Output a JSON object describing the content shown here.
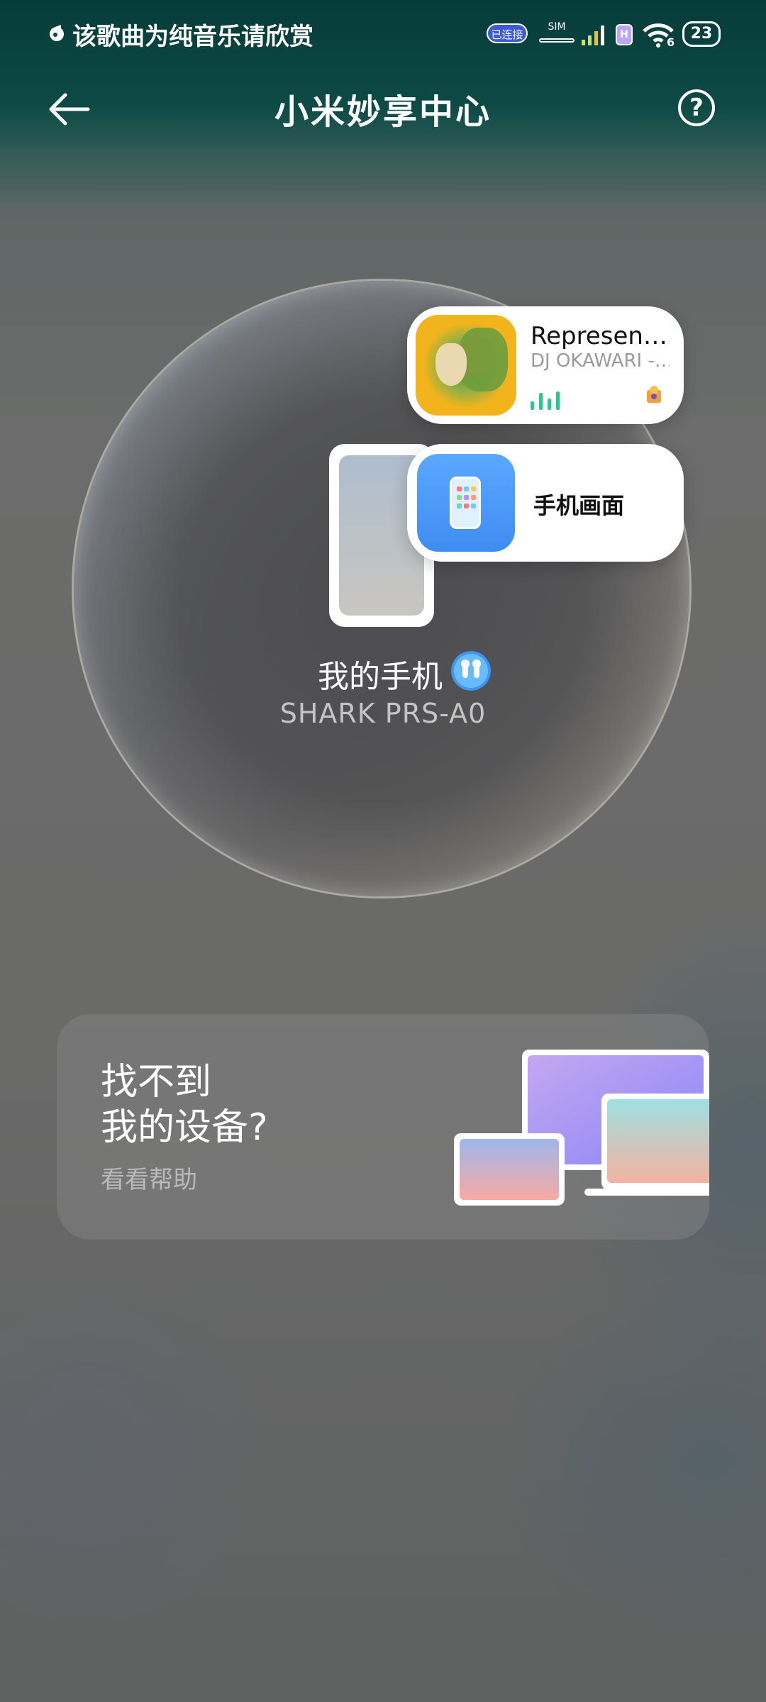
{
  "status_bar": {
    "notification": "该歌曲为纯音乐请欣赏",
    "connected_badge": "已连接",
    "sim_label": "SIM",
    "h_label": "H",
    "wifi_level": "6",
    "battery": "23",
    "icons": [
      "music-note-icon",
      "sim-icon",
      "signal-icon",
      "wifi-icon",
      "battery-icon"
    ]
  },
  "header": {
    "title": "小米妙享中心",
    "back_icon": "arrow-left-icon",
    "help_symbol": "?"
  },
  "device": {
    "name": "我的手机",
    "model": "SHARK PRS-A0"
  },
  "music_card": {
    "title": "Represen…",
    "artist": "DJ OKAWARI -…"
  },
  "mirror_card": {
    "label": "手机画面"
  },
  "help_card": {
    "title_line1": "找不到",
    "title_line2": "我的设备?",
    "link": "看看帮助"
  },
  "colors": {
    "header_bg": "#063b39",
    "page_bg": "#6a6b6a",
    "accent_blue": "#3f8cf2",
    "eq_green": "#34c38f"
  }
}
